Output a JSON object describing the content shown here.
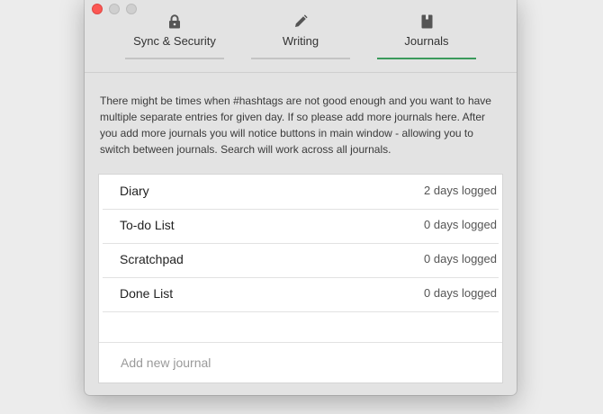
{
  "tabs": [
    {
      "label": "Sync & Security",
      "icon": "lock-icon",
      "active": false
    },
    {
      "label": "Writing",
      "icon": "pencil-icon",
      "active": false
    },
    {
      "label": "Journals",
      "icon": "book-icon",
      "active": true
    }
  ],
  "description": "There might be times when #hashtags are not good enough and you want to have multiple separate entries for given day. If so please add more journals here. After you add more journals you will notice buttons in main window - allowing you to switch between journals. Search will work across all journals.",
  "journals": [
    {
      "name": "Diary",
      "count": "2 days logged"
    },
    {
      "name": "To-do List",
      "count": "0 days logged"
    },
    {
      "name": "Scratchpad",
      "count": "0 days logged"
    },
    {
      "name": "Done List",
      "count": "0 days logged"
    }
  ],
  "add_journal": {
    "placeholder": "Add new journal"
  },
  "colors": {
    "active_tab": "#3a9a5b",
    "close_button": "#fc5753"
  }
}
